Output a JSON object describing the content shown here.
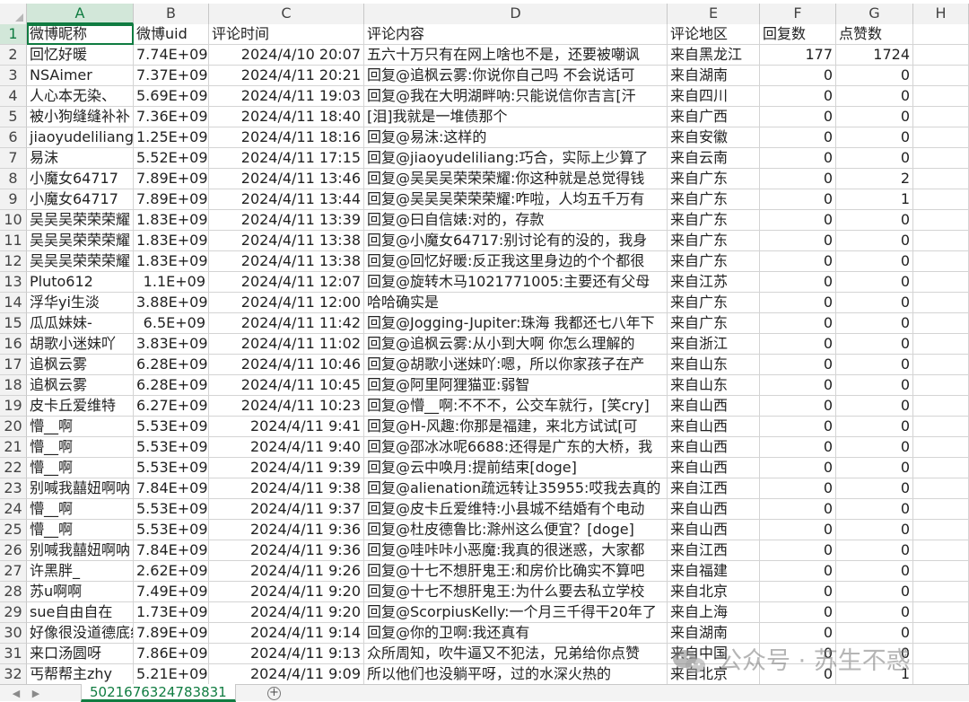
{
  "columns": [
    "A",
    "B",
    "C",
    "D",
    "E",
    "F",
    "G",
    "H"
  ],
  "headers": [
    "微博昵称",
    "微博uid",
    "评论时间",
    "评论内容",
    "评论地区",
    "回复数",
    "点赞数",
    ""
  ],
  "rows": [
    [
      "回忆好暖",
      "7.74E+09",
      "2024/4/10 20:07",
      "五六十万只有在网上啥也不是，还要被嘲讽",
      "来自黑龙江",
      "177",
      "1724"
    ],
    [
      "NSAimer",
      "7.37E+09",
      "2024/4/11 20:21",
      "回复@追枫云雾:你说你自己吗 不会说话可",
      "来自湖南",
      "0",
      "0"
    ],
    [
      "人心本无染、",
      "5.69E+09",
      "2024/4/11 19:03",
      "回复@我在大明湖畔呐:只能说信你吉言[汗",
      "来自四川",
      "0",
      "0"
    ],
    [
      "被小狗缝缝补补",
      "7.36E+09",
      "2024/4/11 18:40",
      "[泪]我就是一堆债那个",
      "来自广西",
      "0",
      "0"
    ],
    [
      "jiaoyudeliliang",
      "1.25E+09",
      "2024/4/11 18:16",
      "回复@易沫:这样的",
      "来自安徽",
      "0",
      "0"
    ],
    [
      "易沫",
      "5.52E+09",
      "2024/4/11 17:15",
      "回复@jiaoyudeliliang:巧合，实际上少算了",
      "来自云南",
      "0",
      "0"
    ],
    [
      "小魔女64717",
      "7.89E+09",
      "2024/4/11 13:46",
      "回复@吴吴吴荣荣荣耀:你这种就是总觉得钱",
      "来自广东",
      "0",
      "2"
    ],
    [
      "小魔女64717",
      "7.89E+09",
      "2024/4/11 13:44",
      "回复@吴吴吴荣荣荣耀:咋啦，人均五千万有",
      "来自广东",
      "0",
      "1"
    ],
    [
      "吴吴吴荣荣荣耀",
      "1.83E+09",
      "2024/4/11 13:39",
      "回复@曰自信婊:对的，存款",
      "来自广东",
      "0",
      "0"
    ],
    [
      "吴吴吴荣荣荣耀",
      "1.83E+09",
      "2024/4/11 13:38",
      "回复@小魔女64717:别讨论有的没的，我身",
      "来自广东",
      "0",
      "0"
    ],
    [
      "吴吴吴荣荣荣耀",
      "1.83E+09",
      "2024/4/11 13:38",
      "回复@回忆好暖:反正我这里身边的个个都很",
      "来自广东",
      "0",
      "0"
    ],
    [
      "Pluto612",
      "1.1E+09",
      "2024/4/11 12:07",
      "回复@旋转木马1021771005:主要还有父母",
      "来自江苏",
      "0",
      "0"
    ],
    [
      "浮华yi生淡",
      "3.88E+09",
      "2024/4/11 12:00",
      "哈哈确实是",
      "来自广东",
      "0",
      "0"
    ],
    [
      "瓜瓜妹妹-",
      "6.5E+09",
      "2024/4/11 11:42",
      "回复@Jogging-Jupiter:珠海 我都还七八年下",
      "来自广东",
      "0",
      "0"
    ],
    [
      "胡歌小迷妹吖",
      "3.83E+09",
      "2024/4/11 11:02",
      "回复@追枫云雾:从小到大啊 你怎么理解的",
      "来自浙江",
      "0",
      "0"
    ],
    [
      "追枫云雾",
      "6.28E+09",
      "2024/4/11 10:46",
      "回复@胡歌小迷妹吖:嗯，所以你家孩子在产",
      "来自山东",
      "0",
      "0"
    ],
    [
      "追枫云雾",
      "6.28E+09",
      "2024/4/11 10:45",
      "回复@阿里阿狸猫亚:弱智",
      "来自山东",
      "0",
      "0"
    ],
    [
      "皮卡丘爱维特",
      "6.27E+09",
      "2024/4/11 10:23",
      "回复@懵__啊:不不不，公交车就行，[笑cry]",
      "来自山西",
      "0",
      "0"
    ],
    [
      "懵__啊",
      "5.53E+09",
      "2024/4/11 9:41",
      "回复@H-风趣:你那是福建，来北方试试[可",
      "来自山西",
      "0",
      "0"
    ],
    [
      "懵__啊",
      "5.53E+09",
      "2024/4/11 9:40",
      "回复@邵冰冰呢6688:还得是广东的大桥，我",
      "来自山西",
      "0",
      "0"
    ],
    [
      "懵__啊",
      "5.53E+09",
      "2024/4/11 9:39",
      "回复@云中唤月:提前结束[doge]",
      "来自山西",
      "0",
      "0"
    ],
    [
      "别喊我囍妞啊呐",
      "7.84E+09",
      "2024/4/11 9:38",
      "回复@alienation疏远转让35955:哎我去真的",
      "来自江西",
      "0",
      "0"
    ],
    [
      "懵__啊",
      "5.53E+09",
      "2024/4/11 9:37",
      "回复@皮卡丘爱维特:小县城不结婚有个电动",
      "来自山西",
      "0",
      "0"
    ],
    [
      "懵__啊",
      "5.53E+09",
      "2024/4/11 9:36",
      "回复@杜皮德鲁比:滁州这么便宜？[doge]",
      "来自山西",
      "0",
      "0"
    ],
    [
      "别喊我囍妞啊呐",
      "7.84E+09",
      "2024/4/11 9:36",
      "回复@哇咔咔小恶魔:我真的很迷惑，大家都",
      "来自江西",
      "0",
      "0"
    ],
    [
      "许黑胖_",
      "2.62E+09",
      "2024/4/11 9:26",
      "回复@十七不想肝鬼王:和房价比确实不算吧",
      "来自福建",
      "0",
      "0"
    ],
    [
      "苏u啊啊",
      "7.49E+09",
      "2024/4/11 9:20",
      "回复@十七不想肝鬼王:为什么要去私立学校",
      "来自北京",
      "0",
      "0"
    ],
    [
      "sue自由自在",
      "1.73E+09",
      "2024/4/11 9:20",
      "回复@ScorpiusKelly:一个月三千得干20年了",
      "来自上海",
      "0",
      "0"
    ],
    [
      "好像很没道德底线",
      "7.89E+09",
      "2024/4/11 9:14",
      "回复@你的卫啊:我还真有",
      "来自湖南",
      "0",
      "0"
    ],
    [
      "来口汤圆呀",
      "7.86E+09",
      "2024/4/11 9:13",
      "众所周知，吹牛逼又不犯法，兄弟给你点赞",
      "来自中国",
      "0",
      "0"
    ],
    [
      "丐帮帮主zhy",
      "5.21E+09",
      "2024/4/11 9:09",
      "所以他们也没躺平呀，过的水深火热的",
      "来自北京",
      "0",
      "1"
    ]
  ],
  "sheet_tab": "5021676324783831",
  "add_sheet_label": "+",
  "nav_prev": "◀",
  "nav_next": "▶",
  "watermark": "公众号 · 苏生不惑",
  "icons": {
    "corner": "select-all-icon",
    "watermark": "wechat-icon"
  },
  "colors": {
    "accent": "#107c41",
    "header_bg": "#f2f2f2",
    "grid": "#d4d4d4"
  }
}
